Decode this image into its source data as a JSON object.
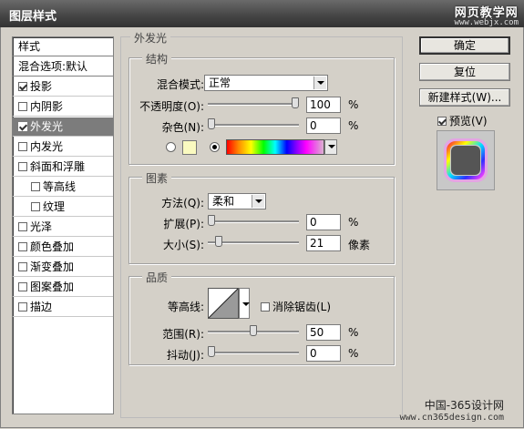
{
  "window": {
    "title": "图层样式"
  },
  "watermark": {
    "line1": "网页教学网",
    "line2": "www.webjx.com"
  },
  "styles_list": {
    "header": "样式",
    "blending": "混合选项:默认",
    "items": [
      {
        "label": "投影",
        "checked": true,
        "selected": false,
        "indent": false
      },
      {
        "label": "内阴影",
        "checked": false,
        "selected": false,
        "indent": false
      },
      {
        "label": "外发光",
        "checked": true,
        "selected": true,
        "indent": false
      },
      {
        "label": "内发光",
        "checked": false,
        "selected": false,
        "indent": false
      },
      {
        "label": "斜面和浮雕",
        "checked": false,
        "selected": false,
        "indent": false
      },
      {
        "label": "等高线",
        "checked": false,
        "selected": false,
        "indent": true
      },
      {
        "label": "纹理",
        "checked": false,
        "selected": false,
        "indent": true
      },
      {
        "label": "光泽",
        "checked": false,
        "selected": false,
        "indent": false
      },
      {
        "label": "颜色叠加",
        "checked": false,
        "selected": false,
        "indent": false
      },
      {
        "label": "渐变叠加",
        "checked": false,
        "selected": false,
        "indent": false
      },
      {
        "label": "图案叠加",
        "checked": false,
        "selected": false,
        "indent": false
      },
      {
        "label": "描边",
        "checked": false,
        "selected": false,
        "indent": false
      }
    ]
  },
  "outer_glow": {
    "title": "外发光",
    "structure": {
      "title": "结构",
      "blend_mode_label": "混合模式:",
      "blend_mode_value": "正常",
      "opacity_label": "不透明度(O):",
      "opacity_value": "100",
      "opacity_level": 1.0,
      "noise_label": "杂色(N):",
      "noise_value": "0",
      "noise_level": 0.0,
      "percent": "%",
      "color_swatch": "#fafac0"
    },
    "elements": {
      "title": "图素",
      "technique_label": "方法(Q):",
      "technique_value": "柔和",
      "spread_label": "扩展(P):",
      "spread_value": "0",
      "spread_level": 0.0,
      "size_label": "大小(S):",
      "size_value": "21",
      "size_level": 0.084,
      "size_unit": "像素",
      "percent": "%"
    },
    "quality": {
      "title": "品质",
      "contour_label": "等高线:",
      "antialias_label": "消除锯齿(L)",
      "antialias_checked": false,
      "range_label": "范围(R):",
      "range_value": "50",
      "range_level": 0.5,
      "jitter_label": "抖动(J):",
      "jitter_value": "0",
      "jitter_level": 0.0,
      "percent": "%"
    }
  },
  "buttons": {
    "ok": "确定",
    "reset": "复位",
    "new_style": "新建样式(W)...",
    "preview_label": "预览(V)",
    "preview_checked": true
  },
  "footer": {
    "line1": "中国-365设计网",
    "line2": "www.cn365design.com"
  }
}
